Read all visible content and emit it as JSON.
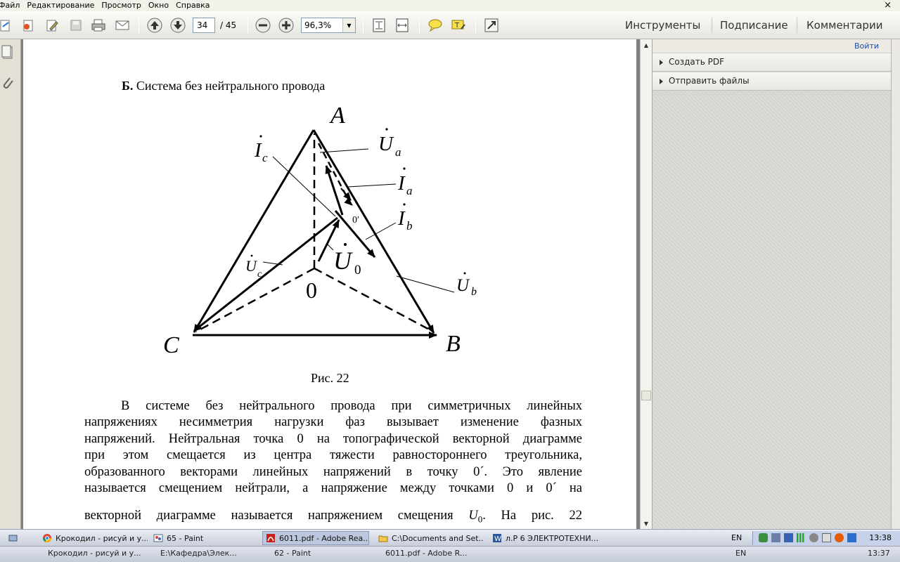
{
  "menu": {
    "items": [
      "Файл",
      "Редактирование",
      "Просмотр",
      "Окно",
      "Справка"
    ],
    "close_glyph": "×"
  },
  "toolbar": {
    "page_current": "34",
    "page_total": "/ 45",
    "zoom": "96,3%",
    "tabs": [
      "Инструменты",
      "Подписание",
      "Комментарии"
    ]
  },
  "right_panel": {
    "login": "Войти",
    "items": [
      "Создать PDF",
      "Отправить файлы"
    ]
  },
  "document": {
    "heading_bold": "Б.",
    "heading_rest": " Система без нейтрального провода",
    "caption": "Рис. 22",
    "labels": {
      "A": "A",
      "B": "B",
      "C": "C",
      "zero": "0",
      "zero_prime": "0′",
      "Ua": "U",
      "Ua_sub": "a",
      "Ia": "I",
      "Ia_sub": "a",
      "Ib": "I",
      "Ib_sub": "b",
      "Ic": "I",
      "Ic_sub": "c",
      "Uc": "U",
      "Uc_sub": "c",
      "Ub": "U",
      "Ub_sub": "b",
      "U0": "U",
      "U0_sub": "0"
    },
    "paragraph_lines": [
      "В системе без нейтрального провода при симметричных линейных",
      "напряжениях несимметрия нагрузки фаз вызывает изменение фазных",
      "напряжений. Нейтральная точка 0 на топографической векторной диаграмме",
      "при этом смещается из центра тяжести равностороннего треугольника,",
      "образованного векторами линейных напряжений в точку 0´. Это явление",
      "называется смещением нейтрали, а напряжение между точками 0 и 0´ на"
    ],
    "last_line_pre": "векторной диаграмме называется напряжением смещения",
    "last_line_sym": "U",
    "last_line_sub": "0",
    "last_line_post": ". На рис. 22"
  },
  "taskbar": {
    "tasks": [
      "Крокодил - рисуй и у...",
      "65 - Paint",
      "6011.pdf - Adobe Rea...",
      "C:\\Documents and Set...",
      "л.Р 6 ЭЛЕКТРОТЕХНИ..."
    ],
    "lang": "EN",
    "clock": "13:38"
  },
  "taskbar2": {
    "tasks": [
      "Крокодил - рисуй и у...",
      "E:\\Кафедра\\Элек...",
      "62 - Paint",
      "6011.pdf - Adobe R..."
    ],
    "lang": "EN",
    "clock": "13:37"
  }
}
